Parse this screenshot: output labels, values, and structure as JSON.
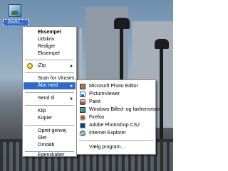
{
  "desktop": {
    "icon_label": "35451..."
  },
  "context_menu": {
    "items": [
      {
        "label": "Eksempel",
        "bold": true
      },
      {
        "label": "Udskriv"
      },
      {
        "label": "Rediger"
      },
      {
        "label": "Eksempel"
      },
      {
        "label": "iZip",
        "submenu": true,
        "icon": "izip-icon"
      },
      {
        "label": "Scan for Viruses..."
      },
      {
        "label": "Åbn med",
        "submenu": true,
        "highlighted": true
      },
      {
        "label": "Send til",
        "submenu": true
      },
      {
        "label": "Klip"
      },
      {
        "label": "Kopier"
      },
      {
        "label": "Opret genvej"
      },
      {
        "label": "Slet"
      },
      {
        "label": "Omdøb"
      },
      {
        "label": "Egenskaber"
      }
    ]
  },
  "open_with_menu": {
    "items": [
      {
        "label": "Microsoft Photo Editor",
        "icon": "photo-editor-icon"
      },
      {
        "label": "PictureViewer",
        "icon": "picture-viewer-icon"
      },
      {
        "label": "Paint",
        "icon": "paint-icon"
      },
      {
        "label": "Windows Billed- og faxfremviser",
        "icon": "image-viewer-icon"
      },
      {
        "label": "Firefox",
        "icon": "firefox-icon"
      },
      {
        "label": "Adobe Photoshop CS2",
        "icon": "photoshop-icon"
      },
      {
        "label": "Internet Explorer",
        "icon": "internet-explorer-icon"
      },
      {
        "label": "Vælg program..."
      }
    ]
  },
  "colors": {
    "highlight": "#316ac5",
    "menu_background": "#ffffff",
    "separator": "#a6a6a6"
  }
}
